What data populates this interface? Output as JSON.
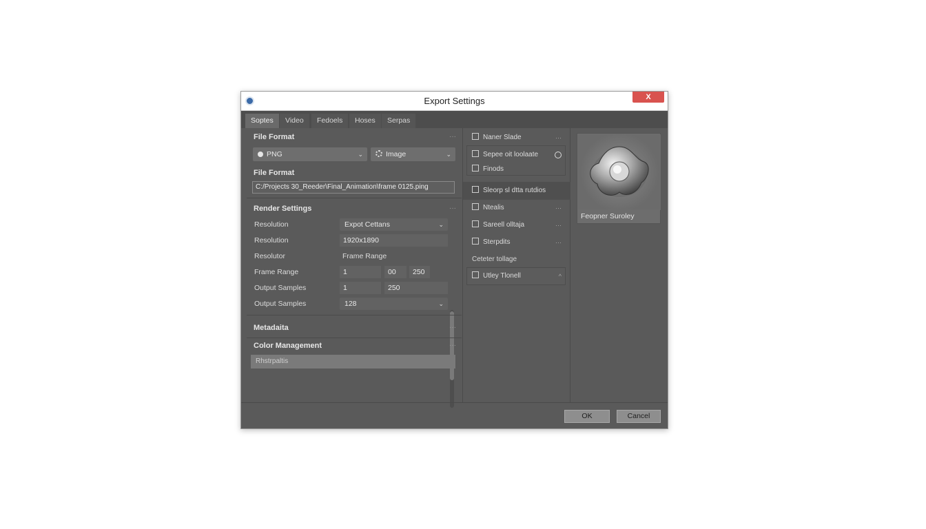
{
  "window": {
    "title": "Export Settings",
    "close_label": "X"
  },
  "tabs": [
    {
      "label": "Soptes",
      "active": true
    },
    {
      "label": "Video",
      "active": false
    },
    {
      "label": "Fedoels",
      "active": false
    },
    {
      "label": "Hoses",
      "active": false
    },
    {
      "label": "Serpas",
      "active": false
    }
  ],
  "file_format": {
    "heading": "File Format",
    "more": "···",
    "format_select": "PNG",
    "type_select": "Image",
    "path_label": "File Format",
    "path_value": "C:/Projects 30_Reeder\\Final_Animation\\frame 0125.ping"
  },
  "render_settings": {
    "heading": "Render Settings",
    "more": "···",
    "rows": [
      {
        "label": "Resolution",
        "value": "Expot Cettans"
      },
      {
        "label": "Resolution",
        "value": "1920x1890"
      },
      {
        "label": "Resolutor",
        "value": "Frame Range"
      },
      {
        "label": "Frame Range",
        "v1": "1",
        "v2": "00",
        "v3": "250"
      },
      {
        "label": "Output Samples",
        "v1": "1",
        "v2": "250"
      },
      {
        "label": "Output Samples",
        "value": "128"
      }
    ]
  },
  "metadata": {
    "heading": "Metadaita",
    "more": "···"
  },
  "color_management": {
    "heading": "Color Management",
    "more": "···",
    "field_value": "Rhstrpaltis"
  },
  "middle_panel": {
    "items": [
      {
        "label": "Naner Slade",
        "trail": "···"
      },
      {
        "label": "Sepee oit loolaate"
      },
      {
        "label": "Finods"
      },
      {
        "label": "Sleorp sl dtta rutdios"
      },
      {
        "label": "Ntealis",
        "trail": "···"
      },
      {
        "label": "Sareell olltaja",
        "trail": "···"
      },
      {
        "label": "Sterpdits",
        "trail": "···"
      },
      {
        "label": "Ceteter tollage"
      },
      {
        "label": "Utley Tlonell",
        "trail": "^"
      }
    ]
  },
  "preview": {
    "label": "Feopner Suroley"
  },
  "footer": {
    "ok_label": "OK",
    "cancel_label": "Cancel"
  },
  "colors": {
    "close_button": "#d9534f",
    "panel_bg": "#5a5a5a",
    "titlebar_bg": "#ffffff"
  }
}
